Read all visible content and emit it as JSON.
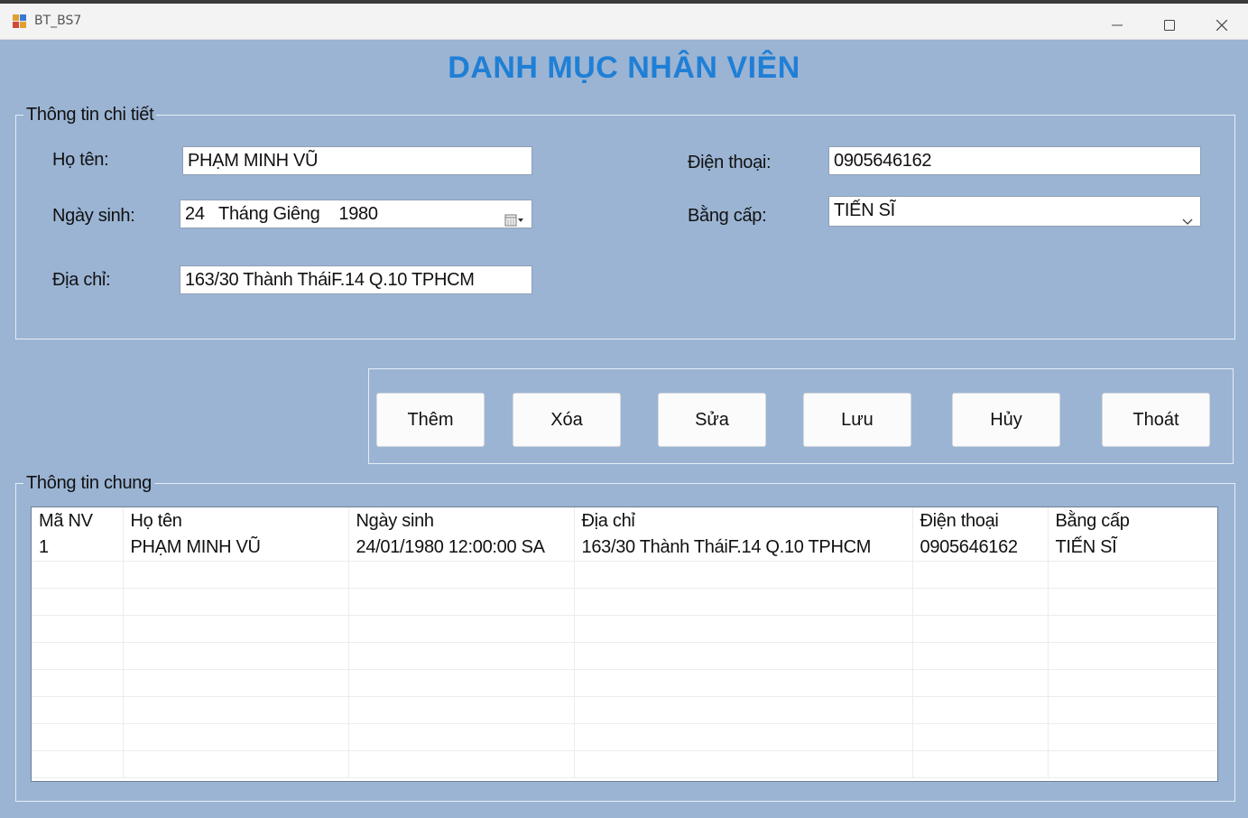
{
  "window": {
    "title": "BT_BS7"
  },
  "heading": "DANH MỤC NHÂN VIÊN",
  "details": {
    "legend": "Thông tin chi tiết",
    "name_label": "Họ tên:",
    "name_value": "PHẠM MINH VŨ",
    "dob_label": "Ngày sinh:",
    "dob_value": "24   Tháng Giêng    1980",
    "address_label": "Địa chỉ:",
    "address_value": "163/30 Thành TháiF.14 Q.10 TPHCM",
    "phone_label": "Điện thoại:",
    "phone_value": "0905646162",
    "degree_label": "Bằng cấp:",
    "degree_value": "TIẾN SĨ"
  },
  "buttons": {
    "add": "Thêm",
    "delete": "Xóa",
    "edit": "Sửa",
    "save": "Lưu",
    "cancel": "Hủy",
    "exit": "Thoát"
  },
  "general": {
    "legend": "Thông tin chung",
    "columns": [
      "Mã NV",
      "Họ tên",
      "Ngày sinh",
      "Địa chỉ",
      "Điện thoại",
      "Bằng cấp"
    ],
    "rows": [
      [
        "1",
        "PHẠM MINH VŨ",
        "24/01/1980 12:00:00 SA",
        "163/30 Thành TháiF.14 Q.10 TPHCM",
        "0905646162",
        "TIẾN SĨ"
      ]
    ]
  },
  "icons": {
    "app": "app-icon",
    "minimize": "minimize-icon",
    "maximize": "maximize-icon",
    "close": "close-icon",
    "calendar": "calendar-icon",
    "dropdown": "chevron-down-icon"
  },
  "colors": {
    "form_bg": "#9bb4d3",
    "heading": "#1f7fd6"
  }
}
